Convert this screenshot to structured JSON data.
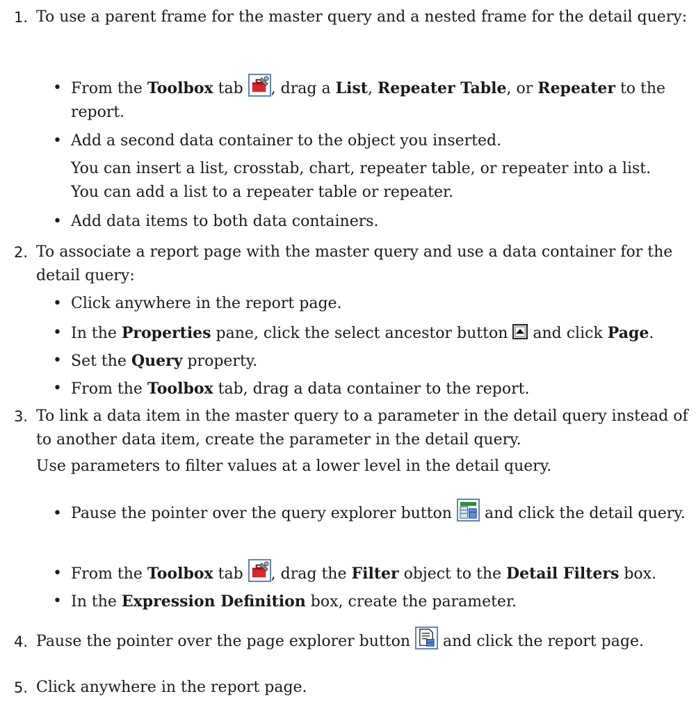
{
  "steps": [
    {
      "num": "1.",
      "text": "To use a parent frame for the master query and a nested frame for the detail query:",
      "bullets": [
        {
          "a": "From the ",
          "b1": "Toolbox",
          "c": " tab ",
          "d": ", drag a ",
          "b2": "List",
          "e": ", ",
          "b3": "Repeater Table",
          "f": ", or ",
          "b4": "Repeater",
          "g": " to the report."
        },
        {
          "text": "Add a second data container to the object you inserted."
        },
        {
          "text": "Add data items to both data containers."
        }
      ],
      "note": "You can insert a list, crosstab, chart, repeater table, or repeater into a list. You can add a list to a repeater table or repeater."
    },
    {
      "num": "2.",
      "text": "To associate a report page with the master query and use a data container for the detail query:",
      "bullets": [
        {
          "text": "Click anywhere in the report page."
        },
        {
          "a": "In the ",
          "b1": "Properties",
          "c": " pane, click the select ancestor button ",
          "d": " and click ",
          "b2": "Page",
          "e": "."
        },
        {
          "a": "Set the ",
          "b1": "Query",
          "c": " property."
        },
        {
          "a": "From the ",
          "b1": "Toolbox",
          "c": " tab, drag a data container to the report."
        }
      ]
    },
    {
      "num": "3.",
      "text": "To link a data item in the master query to a parameter in the detail query instead of to another data item, create the parameter in the detail query.",
      "note": "Use parameters to filter values at a lower level in the detail query.",
      "bullets": [
        {
          "a": "Pause the pointer over the query explorer button ",
          "c": " and click the detail query."
        },
        {
          "a": "From the ",
          "b1": "Toolbox",
          "c": " tab ",
          "d": ", drag the ",
          "b2": "Filter",
          "e": " object to the ",
          "b3": "Detail Filters",
          "f": " box."
        },
        {
          "a": "In the ",
          "b1": "Expression Definition",
          "c": " box, create the parameter."
        }
      ]
    },
    {
      "num": "4.",
      "text_a": "Pause the pointer over the page explorer button ",
      "text_b": " and click the report page."
    },
    {
      "num": "5.",
      "text": "Click anywhere in the report page."
    }
  ],
  "bullet_glyph": "•",
  "icons": {
    "toolbox": "toolbox-icon",
    "select_ancestor": "select-ancestor-icon",
    "query_explorer": "query-explorer-icon",
    "page_explorer": "page-explorer-icon"
  }
}
